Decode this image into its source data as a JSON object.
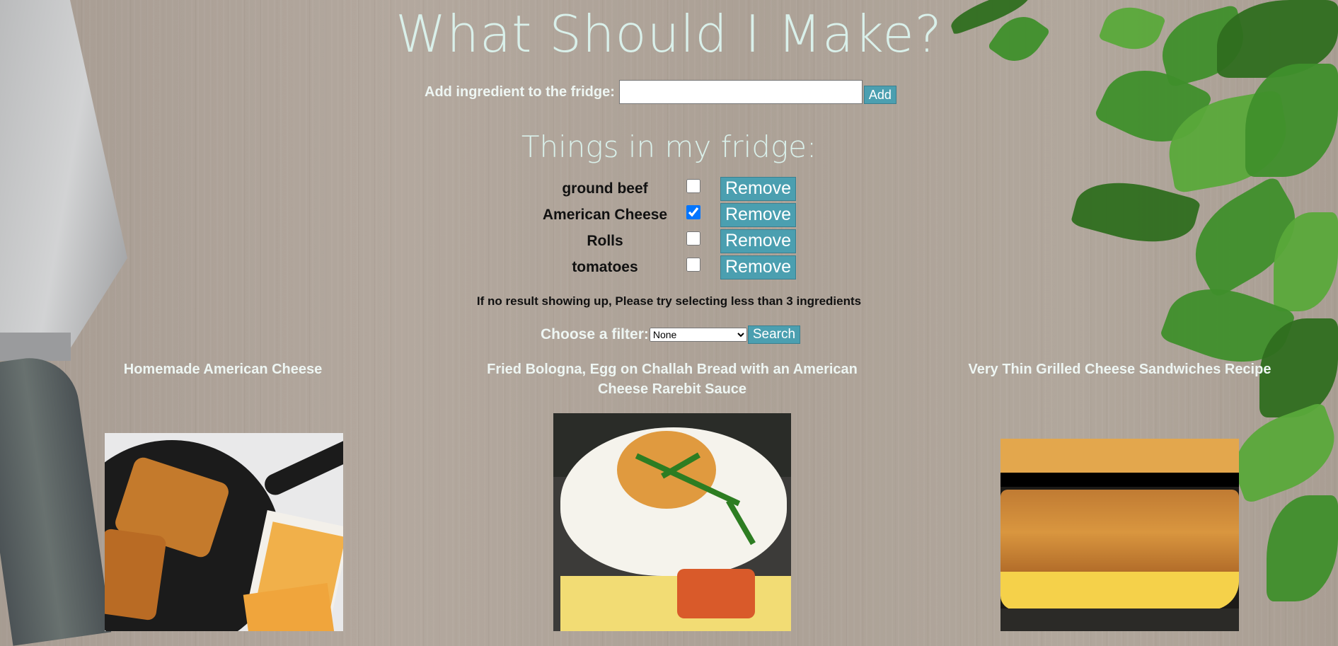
{
  "header": {
    "title": "What Should I Make?"
  },
  "add_form": {
    "label": "Add ingredient to the fridge:",
    "input_value": "",
    "input_placeholder": "",
    "add_label": "Add"
  },
  "fridge": {
    "title": "Things in my fridge:",
    "items": [
      {
        "name": "ground beef",
        "checked": false,
        "remove_label": "Remove"
      },
      {
        "name": "American Cheese",
        "checked": true,
        "remove_label": "Remove"
      },
      {
        "name": "Rolls",
        "checked": false,
        "remove_label": "Remove"
      },
      {
        "name": "tomatoes",
        "checked": false,
        "remove_label": "Remove"
      }
    ]
  },
  "note": "If no result showing up, Please try selecting less than 3 ingredients",
  "filter": {
    "label": "Choose a filter:",
    "selected": "None",
    "search_label": "Search"
  },
  "recipes": [
    {
      "title": "Homemade American Cheese"
    },
    {
      "title": "Fried Bologna, Egg on Challah Bread with an American Cheese Rarebit Sauce"
    },
    {
      "title": "Very Thin Grilled Cheese Sandwiches Recipe"
    }
  ],
  "colors": {
    "heading": "#d9f0ea",
    "button": "#4b9fb0",
    "background": "#ada297"
  }
}
